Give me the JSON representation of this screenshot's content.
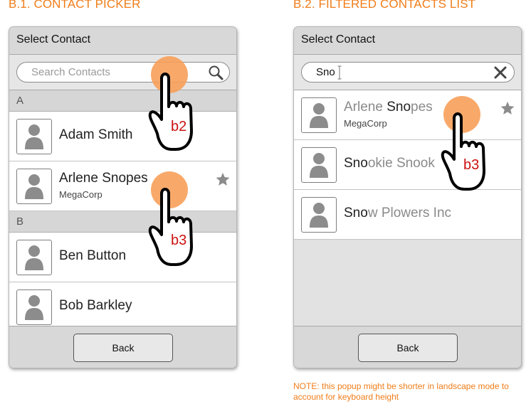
{
  "colors": {
    "accent": "#f07d1a",
    "touch_circle": "#f7a05a",
    "annotation_text": "#cc1111"
  },
  "panel_b1": {
    "section_title": "B.1. CONTACT PICKER",
    "header_title": "Select Contact",
    "search_placeholder": "Search Contacts",
    "search_value": "",
    "search_icon": "magnifier-icon",
    "sections": [
      {
        "letter": "A",
        "contacts": [
          {
            "name": "Adam Smith",
            "company": "",
            "starred": false
          },
          {
            "name": "Arlene Snopes",
            "company": "MegaCorp",
            "starred": true
          }
        ]
      },
      {
        "letter": "B",
        "contacts": [
          {
            "name": "Ben Button",
            "company": "",
            "starred": false
          },
          {
            "name": "Bob Barkley",
            "company": "",
            "starred": false
          }
        ]
      }
    ],
    "back_label": "Back",
    "touch_labels": [
      "b2",
      "b3"
    ]
  },
  "panel_b2": {
    "section_title": "B.2. FILTERED CONTACTS LIST",
    "header_title": "Select Contact",
    "search_value": "Sno",
    "clear_icon": "close-x-icon",
    "results": [
      {
        "match": "Arlene Sno",
        "rest": "pes",
        "company": "MegaCorp",
        "starred": true
      },
      {
        "match": "Sno",
        "rest": "okie Snook",
        "company": "",
        "starred": false
      },
      {
        "match": "Sno",
        "rest": "w Plowers Inc",
        "company": "",
        "starred": false
      }
    ],
    "back_label": "Back",
    "touch_labels": [
      "b3"
    ]
  },
  "note": "NOTE: this popup might be shorter in landscape mode to account for keyboard height"
}
